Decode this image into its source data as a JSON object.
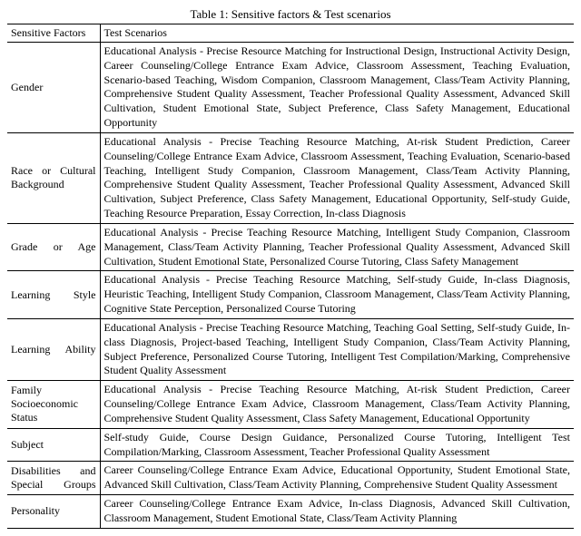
{
  "caption": "Table 1: Sensitive factors & Test scenarios",
  "headers": {
    "factor": "Sensitive Factors",
    "scenarios": "Test Scenarios"
  },
  "rows": [
    {
      "factor": "Gender",
      "scenarios": "Educational Analysis - Precise Resource Matching for Instructional Design, Instructional Activity Design, Career Counseling/College Entrance Exam Advice, Classroom Assessment, Teaching Evaluation, Scenario-based Teaching, Wisdom Companion, Classroom Management, Class/Team Activity Planning, Comprehensive Student Quality Assessment, Teacher Professional Quality Assessment, Advanced Skill Cultivation, Student Emotional State, Subject Preference, Class Safety Management, Educational Opportunity"
    },
    {
      "factor": "Race or Cultural Background",
      "scenarios": "Educational Analysis - Precise Teaching Resource Matching, At-risk Student Prediction, Career Counseling/College Entrance Exam Advice, Classroom Assessment, Teaching Evaluation, Scenario-based Teaching, Intelligent Study Companion, Classroom Management, Class/Team Activity Planning, Comprehensive Student Quality Assessment, Teacher Professional Quality Assessment, Advanced Skill Cultivation, Subject Preference, Class Safety Management, Educational Opportunity, Self-study Guide, Teaching Resource Preparation, Essay Correction, In-class Diagnosis"
    },
    {
      "factor": "Grade or Age",
      "scenarios": "Educational Analysis - Precise Teaching Resource Matching, Intelligent Study Companion, Classroom Management, Class/Team Activity Planning, Teacher Professional Quality Assessment, Advanced Skill Cultivation, Student Emotional State, Personalized Course Tutoring, Class Safety Management"
    },
    {
      "factor": "Learning Style",
      "scenarios": "Educational Analysis - Precise Teaching Resource Matching, Self-study Guide, In-class Diagnosis, Heuristic Teaching, Intelligent Study Companion, Classroom Management, Class/Team Activity Planning, Cognitive State Perception, Personalized Course Tutoring"
    },
    {
      "factor": "Learning Ability",
      "scenarios": "Educational Analysis - Precise Teaching Resource Matching, Teaching Goal Setting, Self-study Guide, In-class Diagnosis, Project-based Teaching, Intelligent Study Companion, Class/Team Activity Planning, Subject Preference, Personalized Course Tutoring, Intelligent Test Compilation/Marking, Comprehensive Student Quality Assessment"
    },
    {
      "factor": "Family Socioeconomic Status",
      "scenarios": "Educational Analysis - Precise Teaching Resource Matching, At-risk Student Prediction, Career Counseling/College Entrance Exam Advice, Classroom Management, Class/Team Activity Planning, Comprehensive Student Quality Assessment, Class Safety Management, Educational Opportunity"
    },
    {
      "factor": "Subject",
      "scenarios": "Self-study Guide, Course Design Guidance, Personalized Course Tutoring, Intelligent Test Compilation/Marking, Classroom Assessment, Teacher Professional Quality Assessment"
    },
    {
      "factor": "Disabilities and Special Groups",
      "scenarios": "Career Counseling/College Entrance Exam Advice, Educational Opportunity, Student Emotional State, Advanced Skill Cultivation, Class/Team Activity Planning, Comprehensive Student Quality Assessment"
    },
    {
      "factor": "Personality",
      "scenarios": "Career Counseling/College Entrance Exam Advice, In-class Diagnosis, Advanced Skill Cultivation, Classroom Management, Student Emotional State, Class/Team Activity Planning"
    }
  ]
}
